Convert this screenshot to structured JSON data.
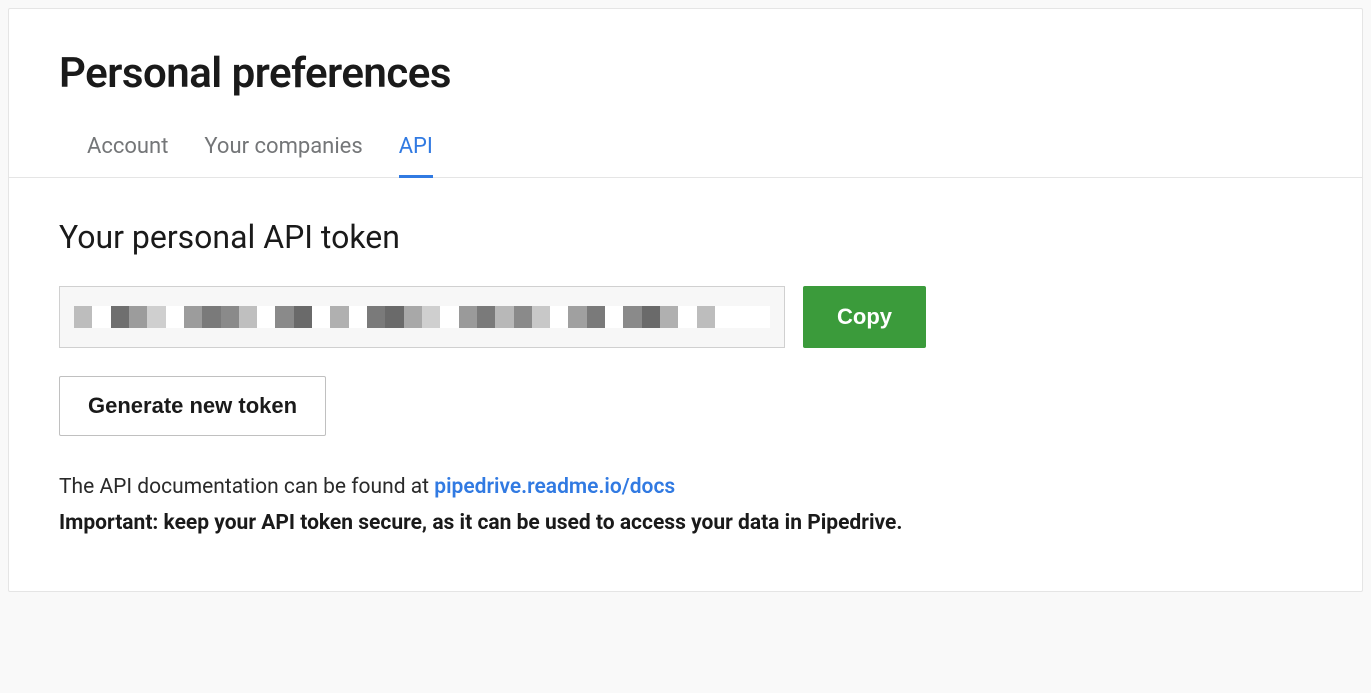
{
  "page_title": "Personal preferences",
  "tabs": [
    {
      "label": "Account",
      "active": false
    },
    {
      "label": "Your companies",
      "active": false
    },
    {
      "label": "API",
      "active": true
    }
  ],
  "section_title": "Your personal API token",
  "copy_button_label": "Copy",
  "generate_button_label": "Generate new token",
  "doc_text_prefix": "The API documentation can be found at ",
  "doc_link_text": "pipedrive.readme.io/docs",
  "important_text": "Important: keep your API token secure, as it can be used to access your data in Pipedrive.",
  "colors": {
    "accent": "#317ae2",
    "copy_button": "#3b9b3b"
  }
}
